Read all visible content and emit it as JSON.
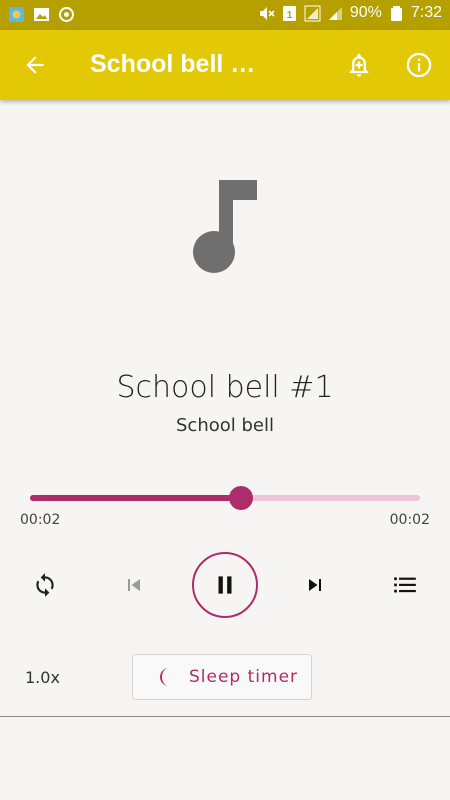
{
  "status_bar": {
    "battery": "90%",
    "time": "7:32",
    "icons": [
      "app-icon",
      "image-icon",
      "sync-icon",
      "mute-icon",
      "sim-icon",
      "signal-icon",
      "signal-icon",
      "battery-icon"
    ]
  },
  "app_bar": {
    "title": "School bell …",
    "back_icon": "arrow-back-icon",
    "actions": [
      "add-alarm-icon",
      "info-icon"
    ],
    "color": "#e2c805"
  },
  "track": {
    "title": "School bell #1",
    "subtitle": "School bell"
  },
  "seek": {
    "progress": 0.54,
    "elapsed": "00:02",
    "duration": "00:02",
    "accent": "#ad2d6a"
  },
  "controls": {
    "repeat_icon": "repeat-icon",
    "previous_icon": "skip-previous-icon",
    "play_pause_icon": "pause-icon",
    "next_icon": "skip-next-icon",
    "queue_icon": "queue-list-icon"
  },
  "footer": {
    "speed": "1.0x",
    "sleep_timer": "Sleep timer"
  }
}
